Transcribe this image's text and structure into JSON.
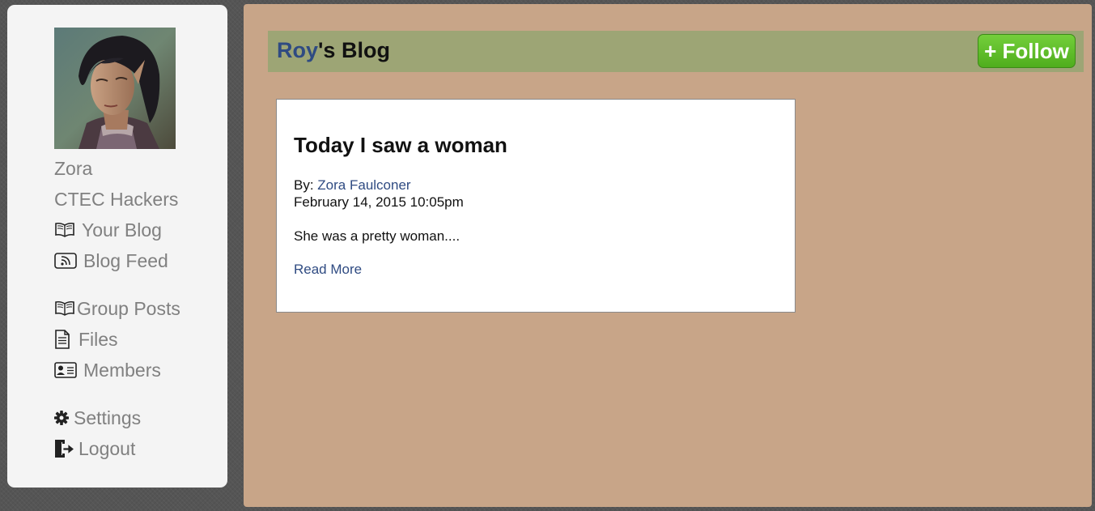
{
  "sidebar": {
    "user_name": "Zora",
    "group_name": "CTEC Hackers",
    "items": [
      {
        "label": "Your Blog",
        "icon": "book-icon"
      },
      {
        "label": "Blog Feed",
        "icon": "rss-icon"
      },
      {
        "label": "Group Posts",
        "icon": "book-icon"
      },
      {
        "label": "Files",
        "icon": "file-icon"
      },
      {
        "label": "Members",
        "icon": "id-card-icon"
      },
      {
        "label": "Settings",
        "icon": "gear-icon"
      },
      {
        "label": "Logout",
        "icon": "logout-icon"
      }
    ]
  },
  "header": {
    "blog_owner": "Roy",
    "title_suffix": "'s Blog",
    "follow_label": "+ Follow"
  },
  "post": {
    "title": "Today I saw a woman",
    "by_prefix": "By: ",
    "author": "Zora Faulconer",
    "date": "February 14, 2015 10:05pm",
    "excerpt": "She was a pretty woman....",
    "read_more": "Read More"
  },
  "colors": {
    "link": "#2f4b82",
    "header_bar": "#9da575",
    "main_background": "#c8a588",
    "follow_button": "#5cbc27",
    "sidebar_background": "#f4f4f4"
  }
}
